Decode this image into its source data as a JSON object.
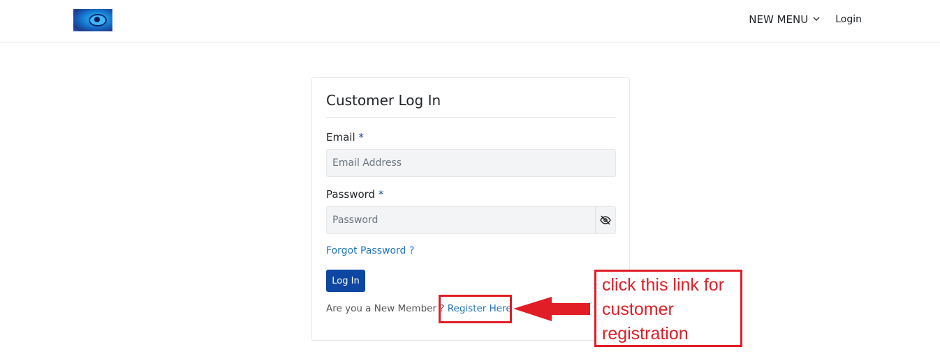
{
  "header": {
    "logo_alt": "site logo",
    "nav": {
      "menu_label": "NEW MENU",
      "login_label": "Login"
    }
  },
  "login_card": {
    "title": "Customer Log In",
    "email": {
      "label": "Email",
      "required_mark": "*",
      "placeholder": "Email Address",
      "value": ""
    },
    "password": {
      "label": "Password",
      "required_mark": "*",
      "placeholder": "Password",
      "value": ""
    },
    "forgot_password": "Forgot Password ?",
    "submit_label": "Log In",
    "member_prompt": "Are you a New Member ?",
    "register_link": "Register Here"
  },
  "annotation": {
    "note": "click this link for customer registration",
    "color": "#e11d26"
  },
  "colors": {
    "primary_button": "#0d47a1",
    "link": "#1e73be"
  },
  "icons": {
    "password_toggle": "eye-slash-icon",
    "menu_dropdown": "chevron-down-icon"
  }
}
